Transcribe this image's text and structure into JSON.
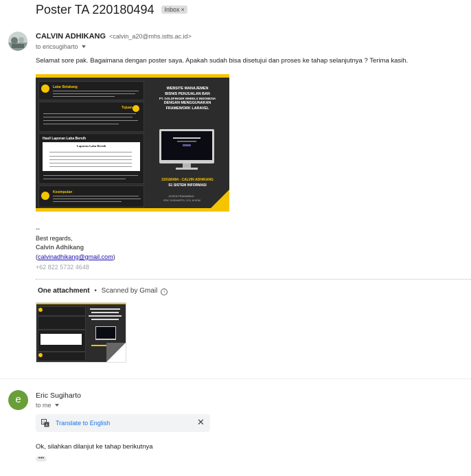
{
  "thread": {
    "subject": "Poster TA 220180494",
    "label": "Inbox"
  },
  "message1": {
    "sender_name": "CALVIN ADHIKANG",
    "sender_email": "<calvin_a20@mhs.istts.ac.id>",
    "to": "to ericsugiharto",
    "body": "Selamat sore pak. Bagaimana dengan poster saya. Apakah sudah bisa disetujui dan proses ke tahap selanjutnya ? Terima kasih.",
    "signature": {
      "dashes": "--",
      "greeting": "Best regards,",
      "name": "Calvin Adhikang",
      "open_paren": "(",
      "email": "calvinadhikang@gmail.com",
      "close_paren": ")",
      "phone": "+62 822 5732 4648"
    },
    "attachments": {
      "count_label": "One attachment",
      "separator": "•",
      "scanned_label": "Scanned by Gmail"
    }
  },
  "poster": {
    "sections": [
      "Latar Belakang",
      "Tujuan",
      "Hasil Laporan Laba Bersih",
      "Kesimpulan"
    ],
    "report_title": "Laporan Laba Bersih",
    "headline": [
      "WEBSITE MANAJEMEN",
      "BISNIS PENJUALAN BAN",
      "PT. GOLDFINGER WHEELS INDONESIA",
      "DENGAN MENGGUNAKAN",
      "FRAMEWORK LARAVEL"
    ],
    "student": "220180494 - CALVIN ADHIKANG",
    "program": "S1 SISTEM INFORMASI",
    "supervisor_label": "DOSEN PEMBIMBING :",
    "supervisor": "ERIC SUGIHARTO, S.SI, M.KOM"
  },
  "message2": {
    "avatar_letter": "e",
    "sender_name": "Eric Sugiharto",
    "to": "to me",
    "translate_label": "Translate to English",
    "body": "Ok, silahkan dilanjut ke tahap berikutnya",
    "more_label": "•••"
  },
  "colors": {
    "accent": "#f5c400",
    "poster_bg": "#2c2c2c",
    "link": "#1a73e8",
    "avatar_e": "#689f38"
  }
}
